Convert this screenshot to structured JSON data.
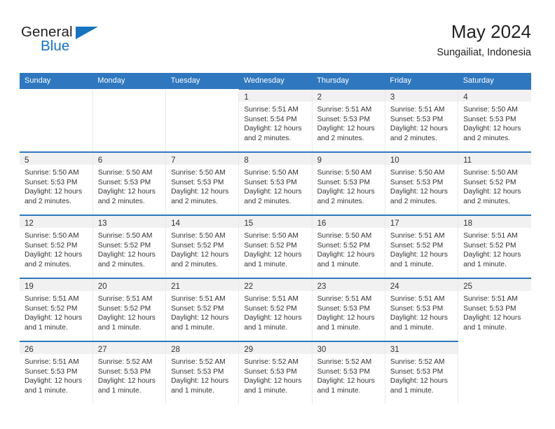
{
  "brand": {
    "name_top": "General",
    "name_bottom": "Blue",
    "triangle_color": "#1673c0",
    "text_color": "#231f20"
  },
  "header": {
    "title": "May 2024",
    "subtitle": "Sungailiat, Indonesia"
  },
  "colors": {
    "header_blue": "#2f78bf",
    "daynum_band": "#f1f1f1",
    "text": "#333333"
  },
  "weekday_headers": [
    "Sunday",
    "Monday",
    "Tuesday",
    "Wednesday",
    "Thursday",
    "Friday",
    "Saturday"
  ],
  "labels": {
    "sunrise_prefix": "Sunrise:",
    "sunset_prefix": "Sunset:",
    "daylight_prefix": "Daylight:"
  },
  "weeks": [
    [
      {
        "empty": true
      },
      {
        "empty": true
      },
      {
        "empty": true
      },
      {
        "day": "1",
        "sunrise": "Sunrise: 5:51 AM",
        "sunset": "Sunset: 5:54 PM",
        "daylight_l1": "Daylight: 12 hours",
        "daylight_l2": "and 2 minutes."
      },
      {
        "day": "2",
        "sunrise": "Sunrise: 5:51 AM",
        "sunset": "Sunset: 5:53 PM",
        "daylight_l1": "Daylight: 12 hours",
        "daylight_l2": "and 2 minutes."
      },
      {
        "day": "3",
        "sunrise": "Sunrise: 5:51 AM",
        "sunset": "Sunset: 5:53 PM",
        "daylight_l1": "Daylight: 12 hours",
        "daylight_l2": "and 2 minutes."
      },
      {
        "day": "4",
        "sunrise": "Sunrise: 5:50 AM",
        "sunset": "Sunset: 5:53 PM",
        "daylight_l1": "Daylight: 12 hours",
        "daylight_l2": "and 2 minutes."
      }
    ],
    [
      {
        "day": "5",
        "sunrise": "Sunrise: 5:50 AM",
        "sunset": "Sunset: 5:53 PM",
        "daylight_l1": "Daylight: 12 hours",
        "daylight_l2": "and 2 minutes."
      },
      {
        "day": "6",
        "sunrise": "Sunrise: 5:50 AM",
        "sunset": "Sunset: 5:53 PM",
        "daylight_l1": "Daylight: 12 hours",
        "daylight_l2": "and 2 minutes."
      },
      {
        "day": "7",
        "sunrise": "Sunrise: 5:50 AM",
        "sunset": "Sunset: 5:53 PM",
        "daylight_l1": "Daylight: 12 hours",
        "daylight_l2": "and 2 minutes."
      },
      {
        "day": "8",
        "sunrise": "Sunrise: 5:50 AM",
        "sunset": "Sunset: 5:53 PM",
        "daylight_l1": "Daylight: 12 hours",
        "daylight_l2": "and 2 minutes."
      },
      {
        "day": "9",
        "sunrise": "Sunrise: 5:50 AM",
        "sunset": "Sunset: 5:53 PM",
        "daylight_l1": "Daylight: 12 hours",
        "daylight_l2": "and 2 minutes."
      },
      {
        "day": "10",
        "sunrise": "Sunrise: 5:50 AM",
        "sunset": "Sunset: 5:53 PM",
        "daylight_l1": "Daylight: 12 hours",
        "daylight_l2": "and 2 minutes."
      },
      {
        "day": "11",
        "sunrise": "Sunrise: 5:50 AM",
        "sunset": "Sunset: 5:52 PM",
        "daylight_l1": "Daylight: 12 hours",
        "daylight_l2": "and 2 minutes."
      }
    ],
    [
      {
        "day": "12",
        "sunrise": "Sunrise: 5:50 AM",
        "sunset": "Sunset: 5:52 PM",
        "daylight_l1": "Daylight: 12 hours",
        "daylight_l2": "and 2 minutes."
      },
      {
        "day": "13",
        "sunrise": "Sunrise: 5:50 AM",
        "sunset": "Sunset: 5:52 PM",
        "daylight_l1": "Daylight: 12 hours",
        "daylight_l2": "and 2 minutes."
      },
      {
        "day": "14",
        "sunrise": "Sunrise: 5:50 AM",
        "sunset": "Sunset: 5:52 PM",
        "daylight_l1": "Daylight: 12 hours",
        "daylight_l2": "and 2 minutes."
      },
      {
        "day": "15",
        "sunrise": "Sunrise: 5:50 AM",
        "sunset": "Sunset: 5:52 PM",
        "daylight_l1": "Daylight: 12 hours",
        "daylight_l2": "and 1 minute."
      },
      {
        "day": "16",
        "sunrise": "Sunrise: 5:50 AM",
        "sunset": "Sunset: 5:52 PM",
        "daylight_l1": "Daylight: 12 hours",
        "daylight_l2": "and 1 minute."
      },
      {
        "day": "17",
        "sunrise": "Sunrise: 5:51 AM",
        "sunset": "Sunset: 5:52 PM",
        "daylight_l1": "Daylight: 12 hours",
        "daylight_l2": "and 1 minute."
      },
      {
        "day": "18",
        "sunrise": "Sunrise: 5:51 AM",
        "sunset": "Sunset: 5:52 PM",
        "daylight_l1": "Daylight: 12 hours",
        "daylight_l2": "and 1 minute."
      }
    ],
    [
      {
        "day": "19",
        "sunrise": "Sunrise: 5:51 AM",
        "sunset": "Sunset: 5:52 PM",
        "daylight_l1": "Daylight: 12 hours",
        "daylight_l2": "and 1 minute."
      },
      {
        "day": "20",
        "sunrise": "Sunrise: 5:51 AM",
        "sunset": "Sunset: 5:52 PM",
        "daylight_l1": "Daylight: 12 hours",
        "daylight_l2": "and 1 minute."
      },
      {
        "day": "21",
        "sunrise": "Sunrise: 5:51 AM",
        "sunset": "Sunset: 5:52 PM",
        "daylight_l1": "Daylight: 12 hours",
        "daylight_l2": "and 1 minute."
      },
      {
        "day": "22",
        "sunrise": "Sunrise: 5:51 AM",
        "sunset": "Sunset: 5:52 PM",
        "daylight_l1": "Daylight: 12 hours",
        "daylight_l2": "and 1 minute."
      },
      {
        "day": "23",
        "sunrise": "Sunrise: 5:51 AM",
        "sunset": "Sunset: 5:53 PM",
        "daylight_l1": "Daylight: 12 hours",
        "daylight_l2": "and 1 minute."
      },
      {
        "day": "24",
        "sunrise": "Sunrise: 5:51 AM",
        "sunset": "Sunset: 5:53 PM",
        "daylight_l1": "Daylight: 12 hours",
        "daylight_l2": "and 1 minute."
      },
      {
        "day": "25",
        "sunrise": "Sunrise: 5:51 AM",
        "sunset": "Sunset: 5:53 PM",
        "daylight_l1": "Daylight: 12 hours",
        "daylight_l2": "and 1 minute."
      }
    ],
    [
      {
        "day": "26",
        "sunrise": "Sunrise: 5:51 AM",
        "sunset": "Sunset: 5:53 PM",
        "daylight_l1": "Daylight: 12 hours",
        "daylight_l2": "and 1 minute."
      },
      {
        "day": "27",
        "sunrise": "Sunrise: 5:52 AM",
        "sunset": "Sunset: 5:53 PM",
        "daylight_l1": "Daylight: 12 hours",
        "daylight_l2": "and 1 minute."
      },
      {
        "day": "28",
        "sunrise": "Sunrise: 5:52 AM",
        "sunset": "Sunset: 5:53 PM",
        "daylight_l1": "Daylight: 12 hours",
        "daylight_l2": "and 1 minute."
      },
      {
        "day": "29",
        "sunrise": "Sunrise: 5:52 AM",
        "sunset": "Sunset: 5:53 PM",
        "daylight_l1": "Daylight: 12 hours",
        "daylight_l2": "and 1 minute."
      },
      {
        "day": "30",
        "sunrise": "Sunrise: 5:52 AM",
        "sunset": "Sunset: 5:53 PM",
        "daylight_l1": "Daylight: 12 hours",
        "daylight_l2": "and 1 minute."
      },
      {
        "day": "31",
        "sunrise": "Sunrise: 5:52 AM",
        "sunset": "Sunset: 5:53 PM",
        "daylight_l1": "Daylight: 12 hours",
        "daylight_l2": "and 1 minute."
      },
      {
        "empty": true
      }
    ]
  ]
}
